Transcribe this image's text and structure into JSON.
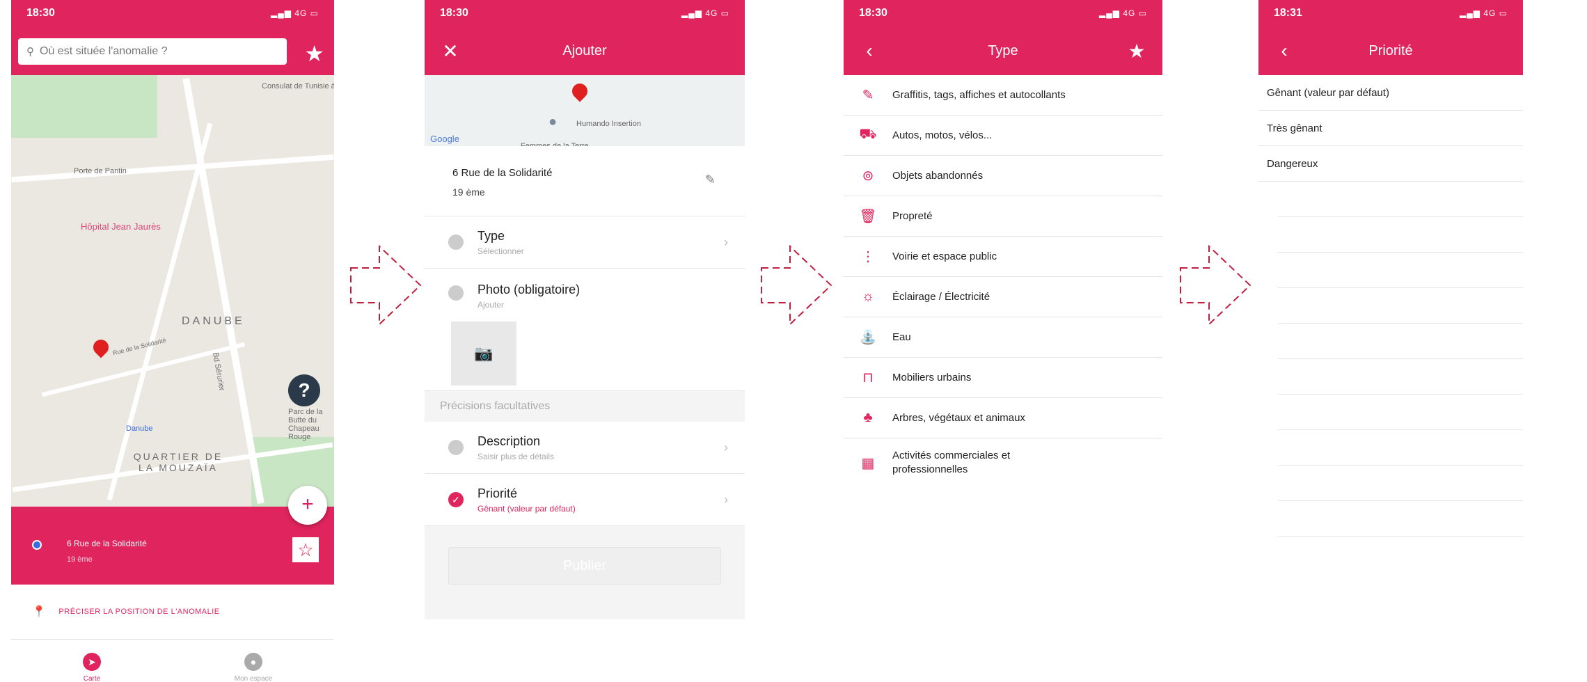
{
  "screen1": {
    "time": "18:30",
    "signal": "4G",
    "search_placeholder": "Où est située l'anomalie ?",
    "map_labels": [
      "Consulat de Tunisie à Pantin",
      "Porte de Pantin",
      "Hôpital Jean Jaurès",
      "DANUBE",
      "Danube",
      "QUARTIER DE LA MOUZAÏA",
      "Parc de la Butte du Chapeau Rouge",
      "Bd Sérurier",
      "Rue de la Solidarité"
    ],
    "address": "6 Rue de la Solidarité",
    "arrondissement": "19 ème",
    "locate_link": "PRÉCISER LA POSITION DE L'ANOMALIE",
    "tabs": [
      {
        "label": "Carte",
        "icon": "compass-icon"
      },
      {
        "label": "Mon espace",
        "icon": "user-icon"
      }
    ]
  },
  "screen2": {
    "time": "18:30",
    "signal": "4G",
    "title": "Ajouter",
    "map_labels": [
      "Humando Insertion",
      "Femmes de la Terre",
      "Google"
    ],
    "address": "6 Rue de la Solidarité",
    "arrondissement": "19 ème",
    "rows": [
      {
        "title": "Type",
        "subtitle": "Sélectionner"
      },
      {
        "title": "Photo (obligatoire)",
        "subtitle": "Ajouter"
      }
    ],
    "section": "Précisions facultatives",
    "optional_rows": [
      {
        "title": "Description",
        "subtitle": "Saisir plus de détails"
      },
      {
        "title": "Priorité",
        "subtitle": "Gênant (valeur par défaut)"
      }
    ],
    "publish": "Publier"
  },
  "screen3": {
    "time": "18:30",
    "signal": "4G",
    "title": "Type",
    "items": [
      {
        "label": "Graffitis, tags, affiches et autocollants",
        "icon": "graffiti-icon"
      },
      {
        "label": "Autos, motos, vélos...",
        "icon": "car-icon"
      },
      {
        "label": "Objets abandonnés",
        "icon": "box-icon"
      },
      {
        "label": "Propreté",
        "icon": "bin-icon"
      },
      {
        "label": "Voirie et espace public",
        "icon": "traffic-light-icon"
      },
      {
        "label": "Éclairage / Électricité",
        "icon": "lamp-icon"
      },
      {
        "label": "Eau",
        "icon": "water-icon"
      },
      {
        "label": "Mobiliers urbains",
        "icon": "bench-icon"
      },
      {
        "label": "Arbres, végétaux et animaux",
        "icon": "tree-icon"
      },
      {
        "label": "Activités commerciales et professionnelles",
        "icon": "shop-icon"
      }
    ]
  },
  "screen4": {
    "time": "18:31",
    "signal": "4G",
    "title": "Priorité",
    "items": [
      "Gênant (valeur par défaut)",
      "Très gênant",
      "Dangereux"
    ]
  },
  "colors": {
    "accent": "#e0245e",
    "map_bg": "#ebe8e2",
    "park": "#c9e6c4"
  }
}
